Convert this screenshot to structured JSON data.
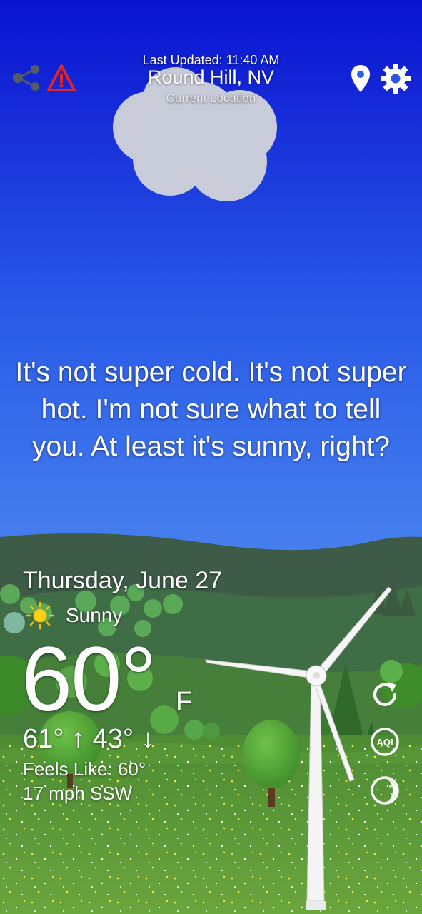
{
  "header": {
    "last_updated": "Last Updated: 11:40 AM",
    "location_name": "Round Hill, NV",
    "location_sub": "Current Location"
  },
  "icons": {
    "share": "share-icon",
    "alert": "alert-warning-icon",
    "location": "map-pin-icon",
    "settings": "gear-icon",
    "refresh": "refresh-icon",
    "aqi": "aqi-icon",
    "moon": "moon-phase-icon"
  },
  "aqi_label": "AQI",
  "quip": "It's not super cold. It's not super hot. I'm not sure what to tell you. At least it's sunny, right?",
  "forecast": {
    "date": "Thursday, June 27",
    "condition": "Sunny",
    "temperature": "60°",
    "unit": "F",
    "hi_lo": "61° ↑ 43° ↓",
    "feels_like": "Feels Like: 60°",
    "wind": "17 mph SSW"
  },
  "colors": {
    "sky_top": "#0a14d2",
    "sky_mid": "#2f67ea",
    "sky_horizon": "#6fb2f6",
    "alert_red": "#e0242b",
    "far_hills": "#3e5c48",
    "grass": "#5c9a3a"
  }
}
